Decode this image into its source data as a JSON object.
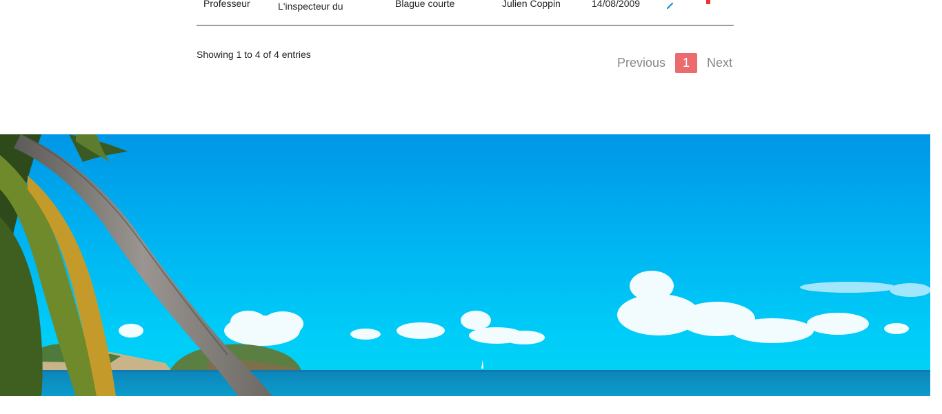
{
  "table": {
    "last_row": {
      "col1": "Professeur",
      "col2": "L'inspecteur du",
      "col3": "Blague courte",
      "col4": "Julien Coppin",
      "col5": "14/08/2009"
    },
    "icons": [
      "edit-icon",
      "delete-icon"
    ]
  },
  "table_info": "Showing 1 to 4 of 4 entries",
  "pagination": {
    "previous": "Previous",
    "current_page": "1",
    "next": "Next"
  },
  "colors": {
    "accent": "#ec6b6e",
    "edit": "#1a8fd8",
    "delete": "#ee3333",
    "sky": "#00b4f0",
    "sea": "#0a8fc0"
  },
  "scrollbar": {
    "up_glyph": "▲",
    "down_glyph": "▼"
  }
}
